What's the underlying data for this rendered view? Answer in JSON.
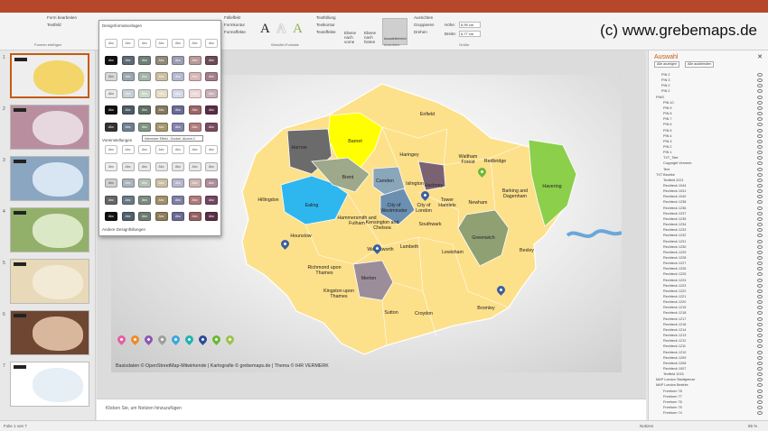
{
  "watermark": "(c) www.grebemaps.de",
  "ribbon": {
    "edit_shape": "Form bearbeiten",
    "textfield": "Textfeld",
    "insert_shapes_label": "Formen einfügen",
    "fill": "Fülleffekt",
    "outline": "Formkontur",
    "effects": "Formeffekte",
    "wordart_label": "WordArt-Formate",
    "text_fill": "Textfüllung",
    "text_outline": "Textkontur",
    "text_effects": "Texteffekte",
    "bring_forward": "Ebene nach vorne",
    "send_backward": "Ebene nach hinten",
    "selection_pane": "Auswahlbereich",
    "align": "Ausrichten",
    "group": "Gruppieren",
    "rotate": "Drehen",
    "arrange_label": "Anordnen",
    "height_label": "Höhe:",
    "height_value": "6,99 cm",
    "width_label": "Breite:",
    "width_value": "6,77 cm",
    "size_label": "Größe"
  },
  "dropdown": {
    "theme_styles_title": "Designformatvorlagen",
    "presets_title": "Voreinstellungen",
    "swatch_text": "Abc",
    "tooltip": "Intensiver Effekt - Dunkel, Akzent 2",
    "other_fills": "Andere Designfüllungen"
  },
  "slides": [
    {
      "num": "1",
      "bg": "#eeeeee",
      "map": "#f4d56a"
    },
    {
      "num": "2",
      "bg": "#b98fa0",
      "map": "#e7d8e0"
    },
    {
      "num": "3",
      "bg": "#8aa6c1",
      "map": "#d8e5f2"
    },
    {
      "num": "4",
      "bg": "#93b06a",
      "map": "#dbe8c6"
    },
    {
      "num": "5",
      "bg": "#e8d9b8",
      "map": "#f3ead6"
    },
    {
      "num": "6",
      "bg": "#6e4632",
      "map": "#d8b79c"
    },
    {
      "num": "7",
      "bg": "#ffffff",
      "map": "#e6eef6"
    }
  ],
  "map": {
    "districts": [
      {
        "name": "Enfield",
        "label": "Enfield"
      },
      {
        "name": "Barnet",
        "label": "Barnet"
      },
      {
        "name": "Harrow",
        "label": "Harrow"
      },
      {
        "name": "Haringey",
        "label": "Haringey"
      },
      {
        "name": "Waltham Forest",
        "label": "Waltham Forest"
      },
      {
        "name": "Redbridge",
        "label": "Redbridge"
      },
      {
        "name": "Havering",
        "label": "Havering"
      },
      {
        "name": "Barking and Dagenham",
        "label": "Barking and Dagenham"
      },
      {
        "name": "Hillingdon",
        "label": "Hillingdon"
      },
      {
        "name": "Ealing",
        "label": "Ealing"
      },
      {
        "name": "Brent",
        "label": "Brent"
      },
      {
        "name": "Camden",
        "label": "Camden"
      },
      {
        "name": "Islington",
        "label": "Islington"
      },
      {
        "name": "Hackney",
        "label": "Hackney"
      },
      {
        "name": "Newham",
        "label": "Newham"
      },
      {
        "name": "Tower Hamlets",
        "label": "Tower Hamlets"
      },
      {
        "name": "City of Westminster",
        "label": "City of Westminster"
      },
      {
        "name": "City of London",
        "label": "City of London"
      },
      {
        "name": "Hammersmith and Fulham",
        "label": "Hammersmith and Fulham"
      },
      {
        "name": "Kensington and Chelsea",
        "label": "Kensington and Chelsea"
      },
      {
        "name": "Southwark",
        "label": "Southwark"
      },
      {
        "name": "Greenwich",
        "label": "Greenwich"
      },
      {
        "name": "Bexley",
        "label": "Bexley"
      },
      {
        "name": "Hounslow",
        "label": "Hounslow"
      },
      {
        "name": "Wandsworth",
        "label": "Wandsworth"
      },
      {
        "name": "Lambeth",
        "label": "Lambeth"
      },
      {
        "name": "Lewisham",
        "label": "Lewisham"
      },
      {
        "name": "Richmond upon Thames",
        "label": "Richmond upon Thames"
      },
      {
        "name": "Merton",
        "label": "Merton"
      },
      {
        "name": "Kingston upon Thames",
        "label": "Kingston upon Thames"
      },
      {
        "name": "Sutton",
        "label": "Sutton"
      },
      {
        "name": "Croydon",
        "label": "Croydon"
      },
      {
        "name": "Bromley",
        "label": "Bromley"
      }
    ],
    "colors": {
      "base": "#fde08a",
      "barnet": "#ffff00",
      "harrow": "#6b6b6b",
      "havering": "#8ccf4b",
      "ealing": "#2eb6ee",
      "brent": "#9ea88a",
      "camden": "#8aa6ba",
      "westminster": "#6a8fb0",
      "hackney": "#7a6272",
      "greenwich": "#8fa073",
      "merton": "#9b8e9a",
      "river": "#6aa7d8"
    },
    "pin_colors": [
      "#e85ea0",
      "#f08a24",
      "#8e55b6",
      "#9e9e9e",
      "#3aa6e0",
      "#1db3b0",
      "#2c4a9a",
      "#6bb834",
      "#9fc24b"
    ],
    "footer": "Basisdaten © OpenStreetMap-Mitwirkende | Kartografie © grebemaps.de | Thema © IHR VERMERK"
  },
  "notes_placeholder": "Klicken Sie, um Notizen hinzuzufügen",
  "status": {
    "slide_info": "Folie 1 von 7",
    "notes_btn": "Notizen",
    "zoom": "85 %"
  },
  "selection_pane": {
    "title": "Auswahl",
    "show_all": "Alle anzeigen",
    "hide_all": "Alle ausblenden",
    "items": [
      "PIN 2",
      "PIN 3",
      "PIN 2",
      "PIN 2",
      "PINS",
      "PIN 10",
      "PIN 9",
      "PIN 8",
      "PIN 7",
      "PIN 6",
      "PIN 5",
      "PIN 4",
      "PIN 3",
      "PIN 2",
      "PIN 1",
      "TXT_Titel",
      "Copyright Vermerk",
      "Text",
      "TXT Bezirke",
      "Textfeld 2221",
      "Rechteck 1044",
      "Rechteck 1041",
      "Rechteck 1040",
      "Rechteck 1238",
      "Rechteck 1236",
      "Rechteck 1237",
      "Rechteck 1235",
      "Rechteck 1234",
      "Rechteck 1233",
      "Rechteck 1232",
      "Rechteck 1231",
      "Rechteck 1230",
      "Rechteck 1229",
      "Rechteck 1228",
      "Rechteck 1227",
      "Rechteck 1226",
      "Rechteck 1225",
      "Rechteck 1224",
      "Rechteck 1223",
      "Rechteck 1222",
      "Rechteck 1221",
      "Rechteck 1220",
      "Rechteck 1219",
      "Rechteck 1218",
      "Rechteck 1217",
      "Rechteck 1216",
      "Rechteck 1214",
      "Rechteck 1213",
      "Rechteck 1212",
      "Rechteck 1211",
      "Rechteck 1210",
      "Rechteck 1209",
      "Rechteck 1208",
      "Rechteck 1007",
      "Textfeld 1015",
      "MAP London Stadtgrenze",
      "MAP London Bezirke",
      "Freeform 78",
      "Freeform 77",
      "Freeform 76",
      "Freeform 75",
      "Freeform 74"
    ]
  }
}
